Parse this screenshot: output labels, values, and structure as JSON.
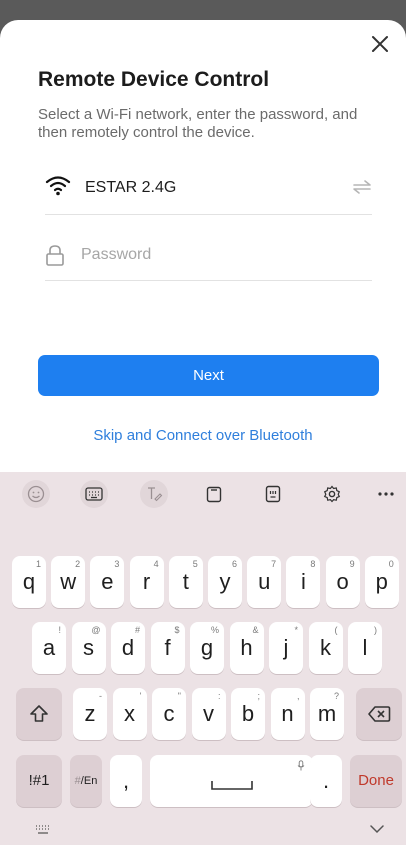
{
  "dialog": {
    "title": "Remote Device Control",
    "subtitle": "Select a Wi-Fi network, enter the password, and then remotely control the device.",
    "wifi_ssid": "ESTAR 2.4G",
    "password_placeholder": "Password",
    "password_value": "",
    "next_label": "Next",
    "bluetooth_link": "Skip and Connect over Bluetooth"
  },
  "colors": {
    "primary": "#1e7ff0",
    "link": "#2f7fdc",
    "done": "#c0392b"
  },
  "keyboard": {
    "toolbar": [
      "emoji-icon",
      "keyboard-icon",
      "handwriting-icon",
      "clipboard-icon",
      "text-edit-icon",
      "settings-icon",
      "more-icon"
    ],
    "row1": [
      {
        "k": "q",
        "h": "1"
      },
      {
        "k": "w",
        "h": "2"
      },
      {
        "k": "e",
        "h": "3"
      },
      {
        "k": "r",
        "h": "4"
      },
      {
        "k": "t",
        "h": "5"
      },
      {
        "k": "y",
        "h": "6"
      },
      {
        "k": "u",
        "h": "7"
      },
      {
        "k": "i",
        "h": "8"
      },
      {
        "k": "o",
        "h": "9"
      },
      {
        "k": "p",
        "h": "0"
      }
    ],
    "row2": [
      {
        "k": "a",
        "h": "!"
      },
      {
        "k": "s",
        "h": "@"
      },
      {
        "k": "d",
        "h": "#"
      },
      {
        "k": "f",
        "h": "$"
      },
      {
        "k": "g",
        "h": "%"
      },
      {
        "k": "h",
        "h": "&"
      },
      {
        "k": "j",
        "h": "*"
      },
      {
        "k": "k",
        "h": "("
      },
      {
        "k": "l",
        "h": ")"
      }
    ],
    "row3": [
      {
        "k": "z",
        "h": "-"
      },
      {
        "k": "x",
        "h": "'"
      },
      {
        "k": "c",
        "h": "\""
      },
      {
        "k": "v",
        "h": ":"
      },
      {
        "k": "b",
        "h": ";"
      },
      {
        "k": "n",
        "h": ","
      },
      {
        "k": "m",
        "h": "?"
      }
    ],
    "symbols_label": "!#1",
    "lang_label": "/En",
    "lang_hint": "#",
    "comma_label": ",",
    "period_label": ".",
    "done_label": "Done"
  }
}
